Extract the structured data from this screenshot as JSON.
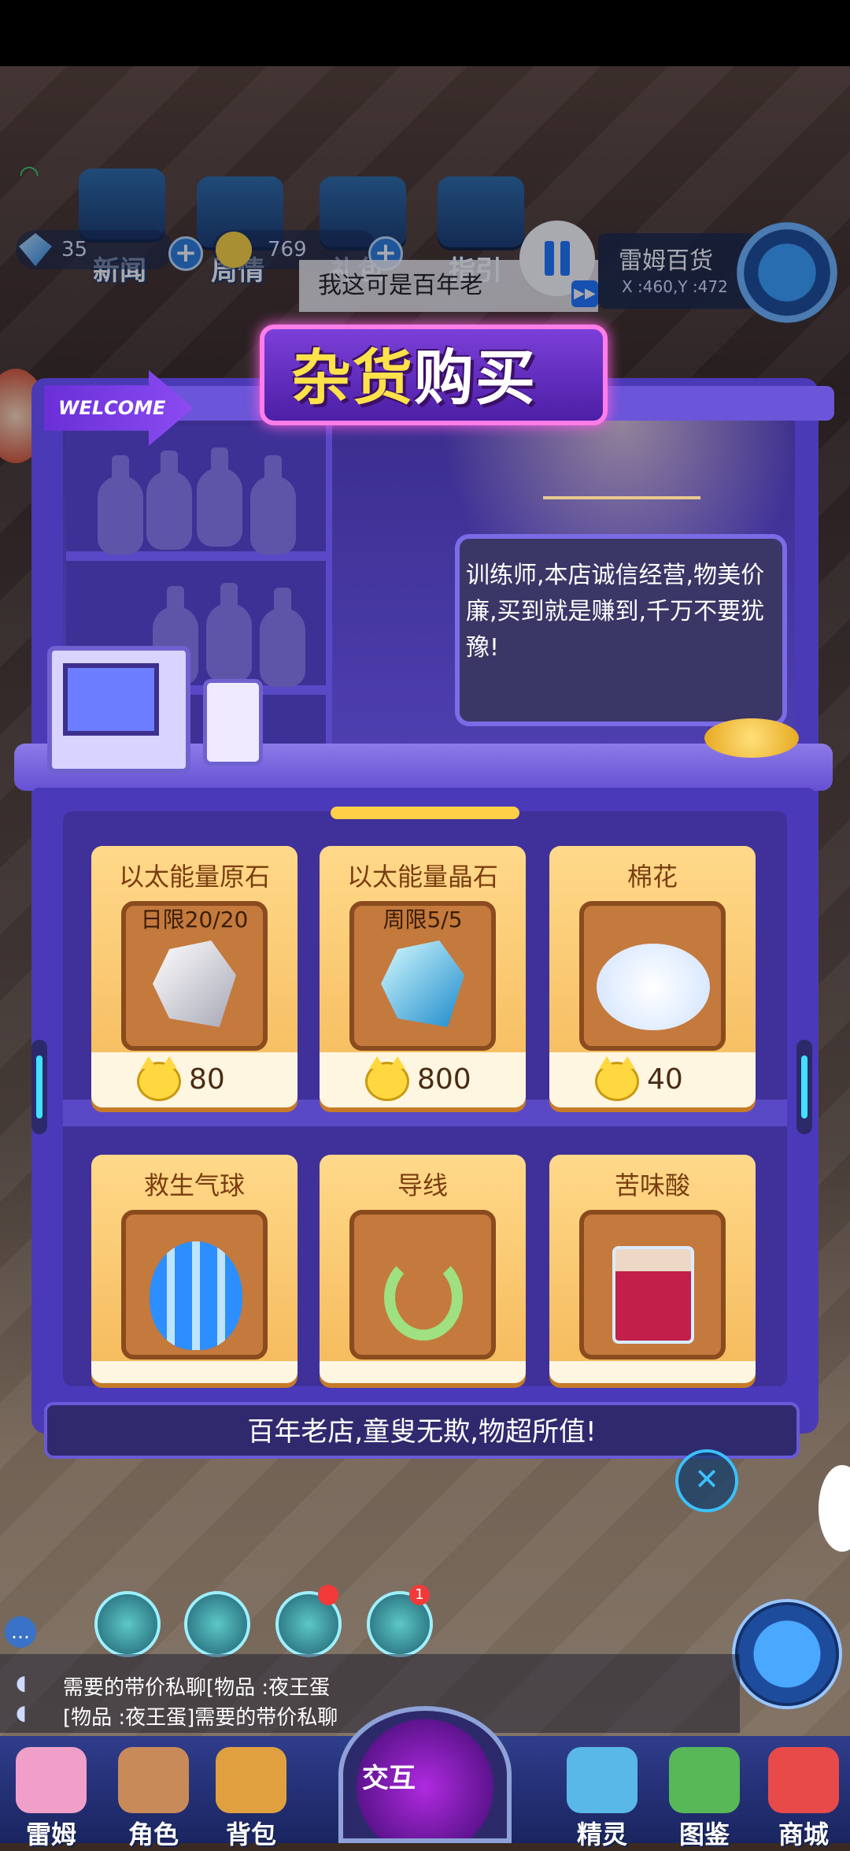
{
  "top_hud": {
    "news_label": "新闻",
    "weekly_label": "周情",
    "gift_label": "礼包",
    "guide_label": "指引",
    "diamond_count": "35",
    "coin_count": "769",
    "hint_text": "我这可是百年老",
    "location_name": "雷姆百货",
    "location_coord": "X :460,Y :472"
  },
  "shop": {
    "title_part1": "杂货",
    "title_part2": "购买",
    "welcome_label": "WELCOME",
    "speech": "训练师,本店诚信经营,物美价廉,买到就是赚到,千万不要犹豫!",
    "slogan": "百年老店,童叟无欺,物超所值!",
    "items": [
      {
        "name": "以太能量原石",
        "limit": "日限20/20",
        "price": "80",
        "icon": "raw-stone-icon"
      },
      {
        "name": "以太能量晶石",
        "limit": "周限5/5",
        "price": "800",
        "icon": "crystal-stone-icon"
      },
      {
        "name": "棉花",
        "limit": "",
        "price": "40",
        "icon": "cotton-icon"
      },
      {
        "name": "救生气球",
        "limit": "",
        "price": "",
        "icon": "balloon-icon"
      },
      {
        "name": "导线",
        "limit": "",
        "price": "",
        "icon": "wire-icon"
      },
      {
        "name": "苦味酸",
        "limit": "",
        "price": "",
        "icon": "beaker-icon"
      }
    ]
  },
  "chat": {
    "line1": "需要的带价私聊[物品 :夜王蛋",
    "line2": "[物品 :夜王蛋]需要的带价私聊"
  },
  "bottom_badges": {
    "bell_count": "1"
  },
  "nav": {
    "items": [
      "雷姆",
      "角色",
      "背包",
      "精灵",
      "图鉴",
      "商城"
    ],
    "center": "交互"
  },
  "colors": {
    "accent": "#4b3ab6",
    "title_yellow": "#ffe14a",
    "card": "#ffd98a"
  }
}
